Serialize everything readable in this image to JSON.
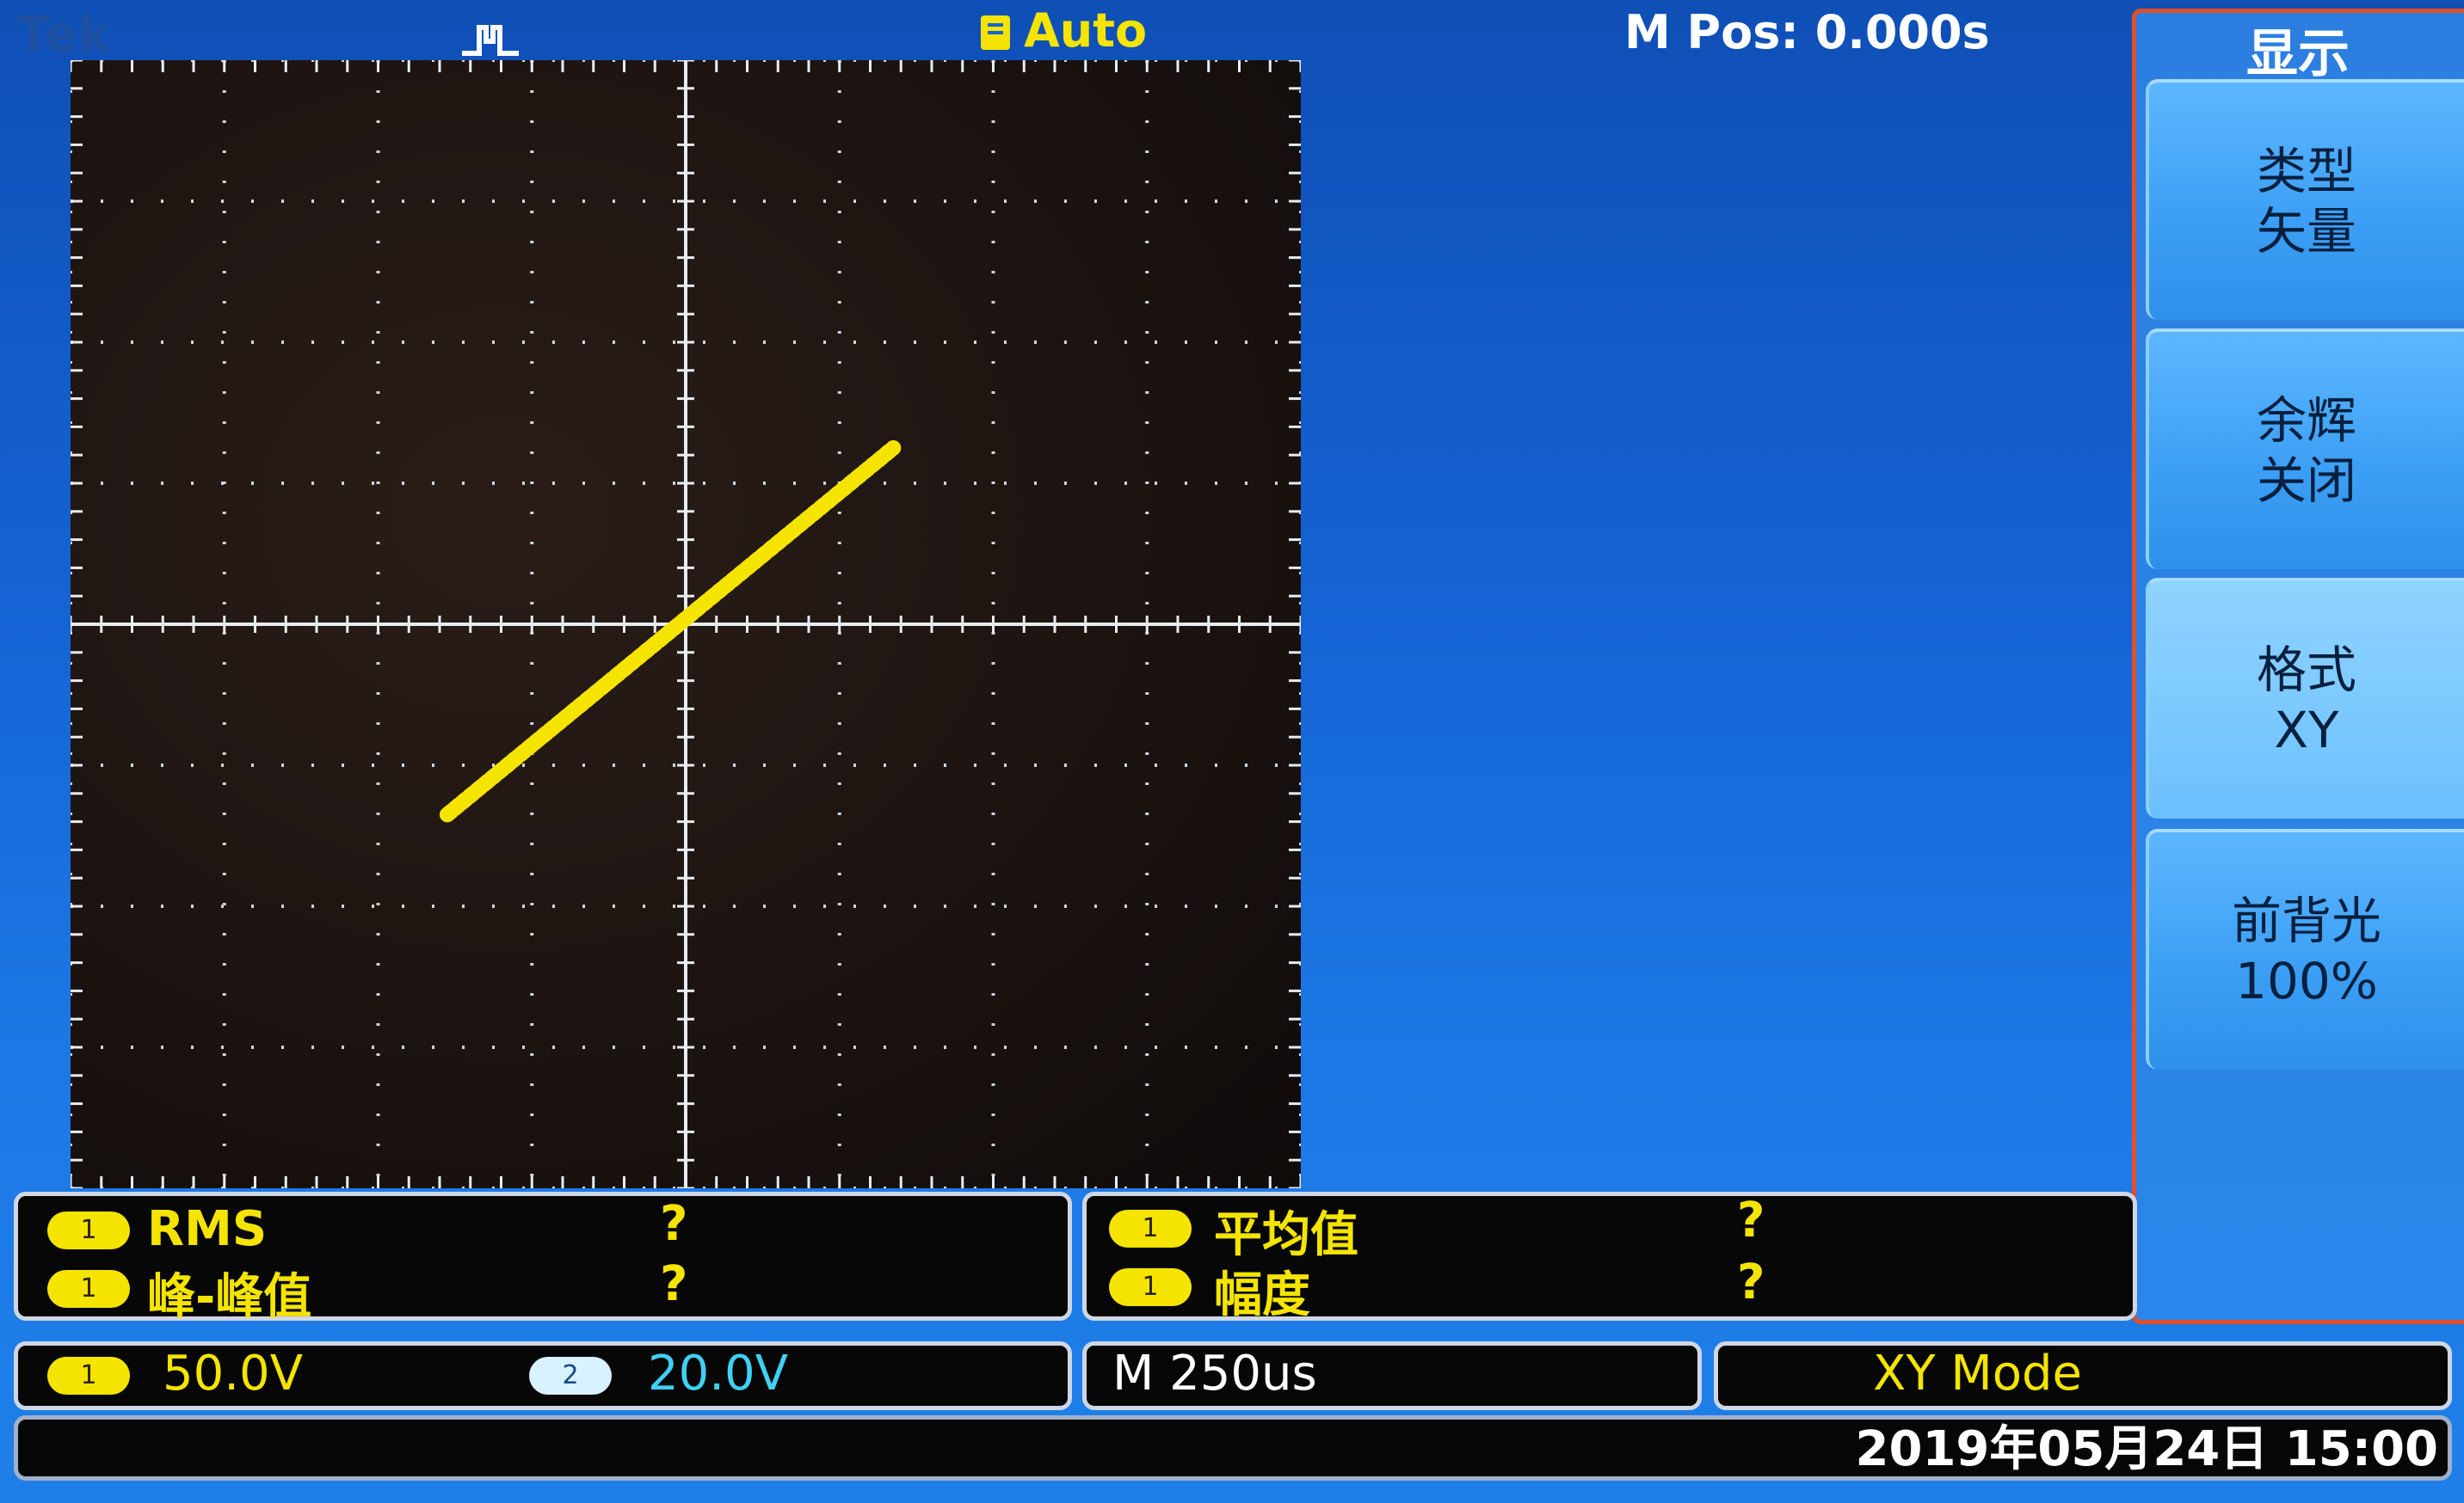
{
  "top_bar": {
    "logo": "Tek",
    "acquisition_mode": "Auto",
    "horizontal_position": "M Pos: 0.000s"
  },
  "side_menu": {
    "title": "显示",
    "items": [
      {
        "line1": "类型",
        "line2": "矢量"
      },
      {
        "line1": "余辉",
        "line2": "关闭"
      },
      {
        "line1": "格式",
        "line2": "XY"
      },
      {
        "line1": "前背光",
        "line2": "100%"
      }
    ]
  },
  "measurements": {
    "left": [
      {
        "channel": "1",
        "label": "RMS",
        "value": "?"
      },
      {
        "channel": "1",
        "label": "峰-峰值",
        "value": "?"
      }
    ],
    "right": [
      {
        "channel": "1",
        "label": "平均值",
        "value": "?"
      },
      {
        "channel": "1",
        "label": "幅度",
        "value": "?"
      }
    ]
  },
  "status": {
    "ch1": {
      "channel": "1",
      "scale": "50.0V"
    },
    "ch2": {
      "channel": "2",
      "scale": "20.0V"
    },
    "timebase": "M 250us",
    "mode": "XY Mode",
    "datetime": "2019年05月24日 15:00"
  },
  "colors": {
    "ch1": "#f4e400",
    "ch2": "#3fd0f5",
    "background": "#1563d4"
  },
  "trace": {
    "channel": "1",
    "x_div_start": -1.55,
    "y_div_start": -1.35,
    "x_div_end": 1.35,
    "y_div_end": 1.25
  }
}
